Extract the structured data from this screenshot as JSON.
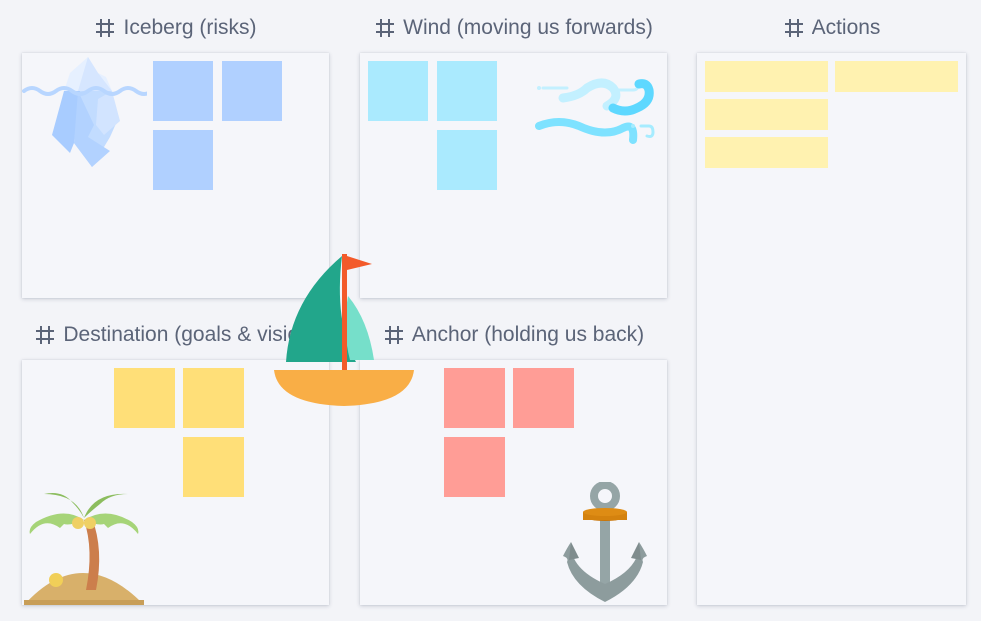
{
  "board": {
    "frames": [
      {
        "id": "iceberg",
        "title": "Iceberg (risks)",
        "icon": "iceberg-icon",
        "sticky_color": "#b0d0ff",
        "sticky_count": 3
      },
      {
        "id": "wind",
        "title": "Wind (moving us forwards)",
        "icon": "wind-icon",
        "sticky_color": "#aaeafe",
        "sticky_count": 3
      },
      {
        "id": "actions",
        "title": "Actions",
        "icon": "",
        "sticky_color": "#fff2b0",
        "sticky_count": 4
      },
      {
        "id": "destination",
        "title": "Destination (goals & visio...",
        "icon": "palm-island-icon",
        "sticky_color": "#ffdf78",
        "sticky_count": 3
      },
      {
        "id": "anchor",
        "title": "Anchor (holding us back)",
        "icon": "anchor-icon",
        "sticky_color": "#ff9d96",
        "sticky_count": 3
      }
    ],
    "frame_icon": "frame-hash-icon",
    "center_decoration": "sailboat-icon",
    "colors": {
      "background": "#f3f4f8",
      "frame_fill": "#f5f6fa",
      "title_text": "#5b6478"
    }
  }
}
